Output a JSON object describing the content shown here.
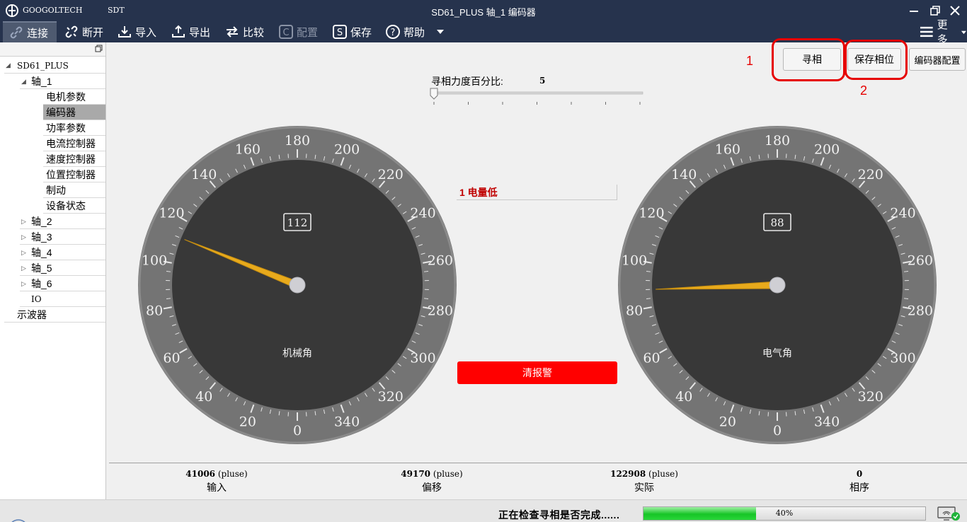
{
  "window": {
    "brand": "GOOGOLTECH",
    "app": "SDT",
    "title": "SD61_PLUS  轴_1 编码器"
  },
  "toolbar": {
    "connect": "连接",
    "disconnect": "断开",
    "import": "导入",
    "export": "导出",
    "compare": "比较",
    "config": "配置",
    "save": "保存",
    "help": "帮助",
    "more": "更多"
  },
  "tree": {
    "root": "SD61_PLUS",
    "axis1": "轴_1",
    "axis1_children": [
      "电机参数",
      "编码器",
      "功率参数",
      "电流控制器",
      "速度控制器",
      "位置控制器",
      "制动",
      "设备状态"
    ],
    "axis2": "轴_2",
    "axis3": "轴_3",
    "axis4": "轴_4",
    "axis5": "轴_5",
    "axis6": "轴_6",
    "io": "IO",
    "scope": "示波器"
  },
  "actions": {
    "find_phase": "寻相",
    "save_phase": "保存相位",
    "encoder_config": "编码器配置",
    "annotation_1": "1",
    "annotation_2": "2"
  },
  "slider": {
    "label": "寻相力度百分比:",
    "value": "5",
    "percent": 0
  },
  "alarm": {
    "text": "1 电量低",
    "clear_button": "清报警"
  },
  "gauges": {
    "mechanical": {
      "label": "机械角",
      "value": 112,
      "display": "112"
    },
    "electrical": {
      "label": "电气角",
      "value": 88,
      "display": "88"
    },
    "scale_labels": [
      "0",
      "20",
      "40",
      "60",
      "80",
      "100",
      "120",
      "140",
      "160",
      "180",
      "200",
      "220",
      "240",
      "260",
      "280",
      "300",
      "320",
      "340"
    ]
  },
  "stats": {
    "input": {
      "value": "41006",
      "unit": "(pluse)",
      "label": "输入"
    },
    "offset": {
      "value": "49170",
      "unit": "(pluse)",
      "label": "偏移"
    },
    "actual": {
      "value": "122908",
      "unit": "(pluse)",
      "label": "实际"
    },
    "phase_order": {
      "value": "0",
      "label": "相序"
    }
  },
  "status": {
    "message": "正在检查寻相是否完成......",
    "progress": 40,
    "progress_text": "40%"
  },
  "colors": {
    "titlebar": "#26334d",
    "needle": "#e8aa1c",
    "alarm_red": "#ff0000",
    "progress_green": "#16c526"
  }
}
